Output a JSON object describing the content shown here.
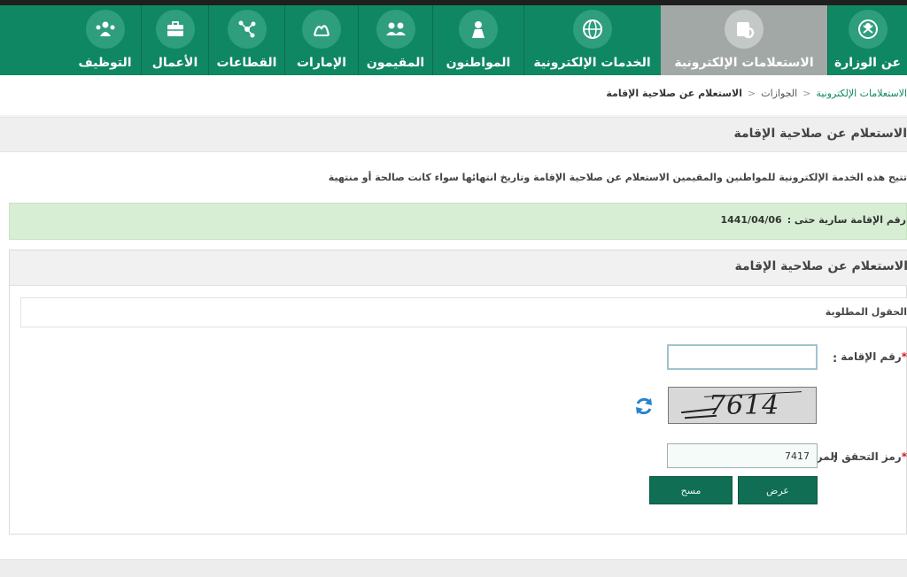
{
  "nav": {
    "items": [
      {
        "label": "عن الوزارة",
        "icon": "emblem-icon"
      },
      {
        "label": "الاستعلامات الإلكترونية",
        "icon": "inquiry-icon",
        "active": true
      },
      {
        "label": "الخدمات الإلكترونية",
        "icon": "globe-icon"
      },
      {
        "label": "المواطنون",
        "icon": "citizen-icon"
      },
      {
        "label": "المقيمون",
        "icon": "residents-icon"
      },
      {
        "label": "الإمارات",
        "icon": "emirates-icon"
      },
      {
        "label": "القطاعات",
        "icon": "sectors-icon"
      },
      {
        "label": "الأعمال",
        "icon": "business-icon"
      },
      {
        "label": "التوظيف",
        "icon": "employment-icon"
      }
    ],
    "active_color": "#a2a8a6",
    "bar_color": "#0f8763"
  },
  "breadcrumb": {
    "first": "الاستعلامات الإلكترونية",
    "second": "الجوازات",
    "current": "الاستعلام عن صلاحية الإقامة",
    "separator": "<"
  },
  "page": {
    "title": "الاستعلام عن صلاحية الإقامة",
    "description": "تتيح هذه الخدمة الإلكترونية للمواطنين والمقيمين الاستعلام عن صلاحية الإقامة وتاريخ انتهائها سواء كانت صالحة أو منتهية"
  },
  "notice": {
    "label": "رقم الإقامة سارية حتى :",
    "value": "1441/04/06"
  },
  "form": {
    "title": "الاستعلام عن صلاحية الإقامة",
    "required_note": "الحقول المطلوبة",
    "field1": {
      "label": "رقم الإقامة",
      "value": "",
      "colon": ":"
    },
    "captcha": {
      "code": "7614"
    },
    "field2": {
      "label": "رمز التحقق المرئي",
      "value": "7417",
      "colon": ":"
    },
    "submit_label": "عرض",
    "clear_label": "مسح"
  }
}
